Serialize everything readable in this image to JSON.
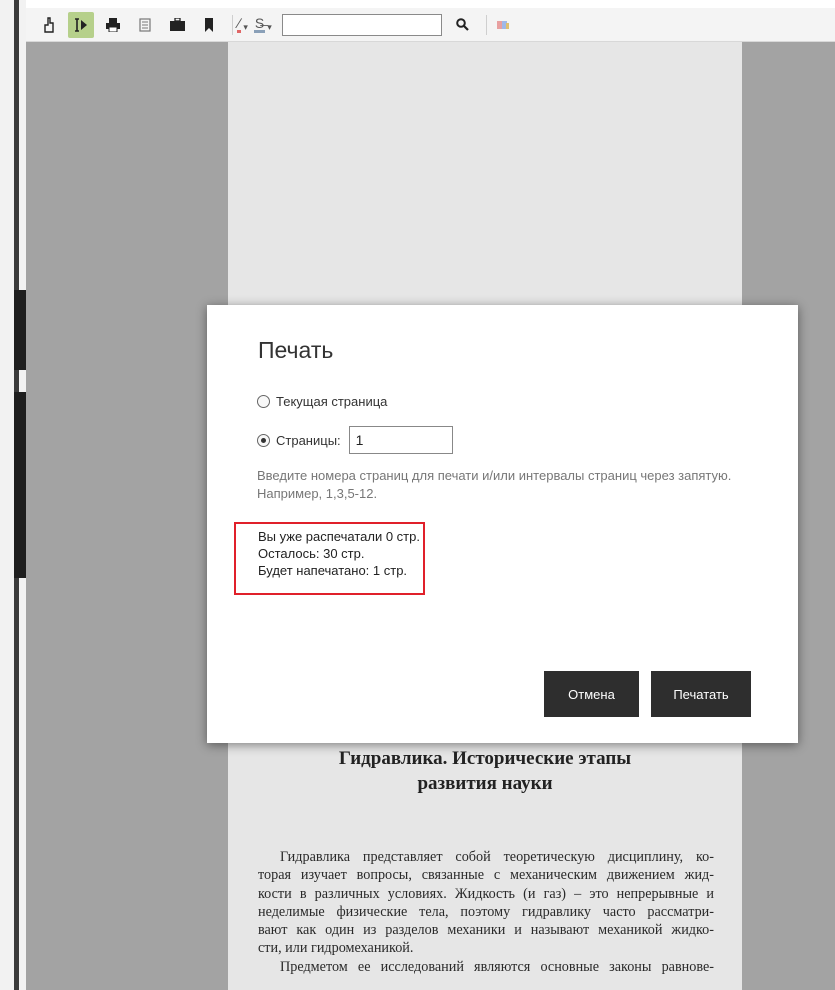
{
  "toolbar": {
    "icons": [
      "hand-icon",
      "text-select-icon",
      "print-icon",
      "page-icon",
      "briefcase-icon",
      "bookmark-icon",
      "pen-icon",
      "strikethrough-icon",
      "search-icon",
      "color-icon"
    ],
    "search_value": "",
    "active_color": "#b6d08b"
  },
  "document": {
    "title_line1": "Гидравлика. Исторические этапы",
    "title_line2": "развития науки",
    "body_lines": [
      "Гидравлика представляет собой теоретическую дисциплину, ко-",
      "торая изучает вопросы, связанные с механическим движением жид-",
      "кости в различных условиях. Жидкость (и газ) – это непрерывные и",
      "неделимые физические тела, поэтому гидравлику часто рассматри-",
      "вают как один из разделов механики и называют механикой жидко-",
      "сти, или гидромеханикой.",
      "Предметом ее исследований являются основные законы равнове-"
    ]
  },
  "dialog": {
    "title": "Печать",
    "option_current": "Текущая страница",
    "option_pages": "Страницы:",
    "pages_value": "1",
    "hint": "Введите номера страниц для печати и/или интервалы страниц через запятую. Например, 1,3,5-12.",
    "stats": {
      "printed": "Вы уже распечатали 0 стр.",
      "remaining": "Осталось: 30 стр.",
      "will_print": "Будет напечатано: 1 стр."
    },
    "cancel_label": "Отмена",
    "print_label": "Печатать",
    "highlight_color": "#e0202a"
  }
}
